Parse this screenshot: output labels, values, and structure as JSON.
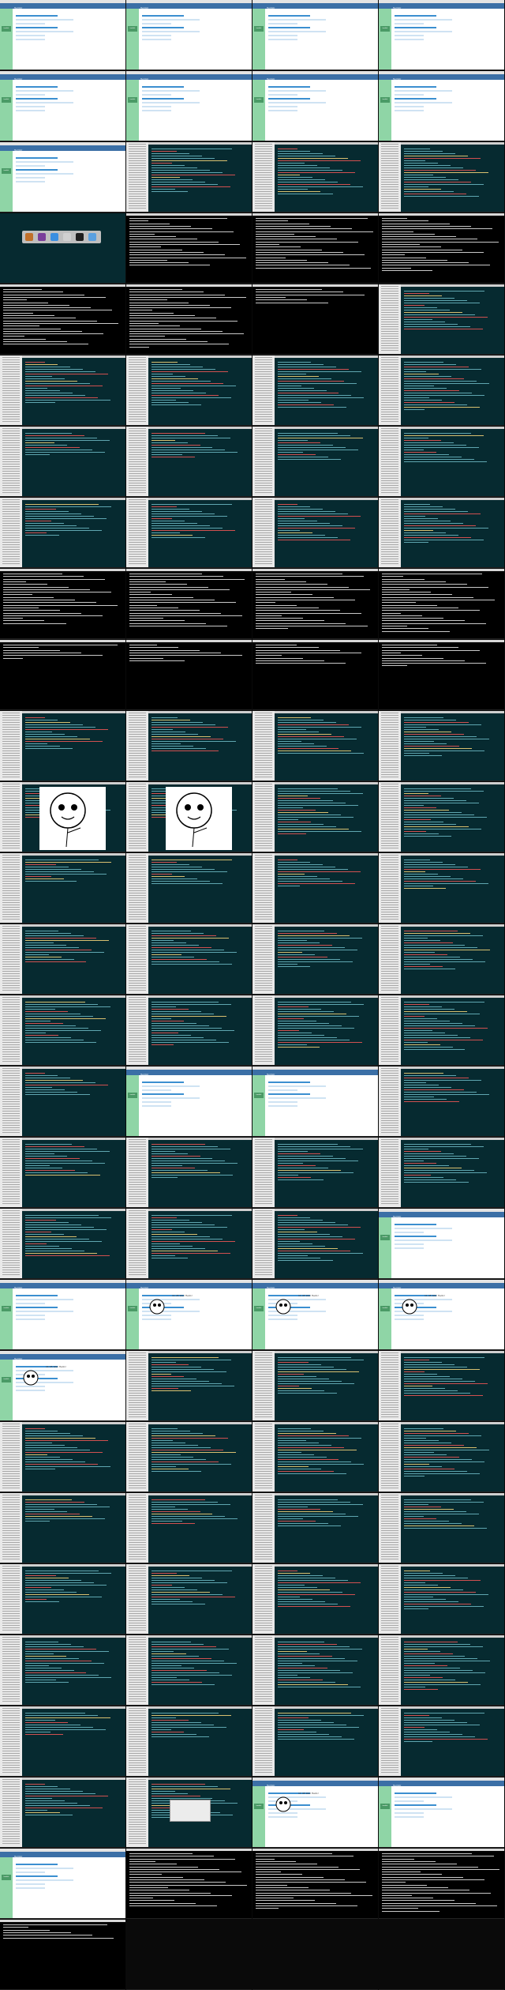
{
  "screenshot": {
    "columns": 4,
    "rows": 27
  },
  "browser": {
    "nav_title": "Tumblr",
    "logo_text": "tumblr."
  },
  "article": {
    "title": "11:45  Well Hello!"
  },
  "tiles": [
    "browser",
    "browser",
    "browser",
    "browser",
    "browser",
    "browser",
    "browser",
    "browser",
    "browser",
    "editor",
    "editor",
    "editor",
    "dock",
    "terminal",
    "terminal",
    "terminal",
    "terminal",
    "terminal",
    "terminal",
    "editor",
    "editor",
    "editor",
    "editor",
    "editor",
    "editor",
    "editor",
    "editor",
    "editor",
    "editor",
    "editor",
    "editor",
    "editor",
    "terminal",
    "terminal",
    "terminal",
    "terminal",
    "terminal",
    "terminal",
    "terminal",
    "terminal",
    "editor",
    "editor",
    "editor",
    "editor",
    "face",
    "face",
    "editor",
    "editor",
    "editor",
    "editor",
    "editor",
    "editor",
    "editor",
    "editor",
    "editor",
    "editor",
    "editor",
    "editor",
    "editor",
    "editor",
    "editor",
    "browser",
    "browser",
    "editor",
    "editor",
    "editor",
    "editor",
    "editor",
    "editor",
    "editor",
    "editor",
    "browser",
    "browser",
    "article",
    "article",
    "article",
    "article",
    "editor",
    "editor",
    "editor",
    "editor",
    "editor",
    "editor",
    "editor",
    "editor",
    "editor",
    "editor",
    "editor",
    "editor",
    "editor",
    "editor",
    "editor",
    "editor",
    "editor",
    "editor",
    "editor",
    "editor",
    "editor",
    "editor",
    "editor",
    "editor",
    "dialog",
    "article",
    "browser",
    "browser",
    "terminal",
    "terminal",
    "terminal",
    "terminal",
    "empty",
    "empty",
    "empty"
  ]
}
